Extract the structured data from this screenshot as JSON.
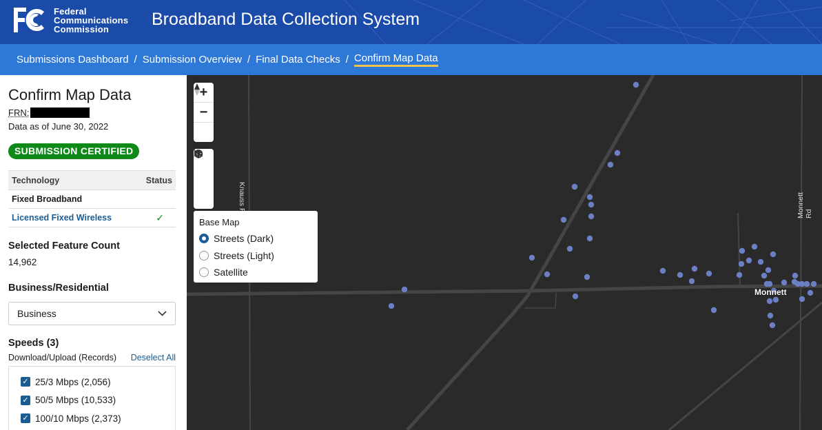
{
  "header": {
    "logo_lines": [
      "Federal",
      "Communications",
      "Commission"
    ],
    "app_title": "Broadband Data Collection System"
  },
  "breadcrumb": {
    "items": [
      "Submissions Dashboard",
      "Submission Overview",
      "Final Data Checks",
      "Confirm Map Data"
    ],
    "separator": "/"
  },
  "sidebar": {
    "title": "Confirm Map Data",
    "frn_label": "FRN:",
    "data_as_of": "Data as of June 30, 2022",
    "status_badge": "SUBMISSION CERTIFIED",
    "tech_table": {
      "headers": [
        "Technology",
        "Status"
      ],
      "rows": [
        {
          "technology": "Fixed Broadband",
          "status": ""
        },
        {
          "technology": "Licensed Fixed Wireless",
          "status": "✓"
        }
      ]
    },
    "feature_count_label": "Selected Feature Count",
    "feature_count_value": "14,962",
    "business_label": "Business/Residential",
    "business_selected": "Business",
    "speeds_label": "Speeds (3)",
    "speeds_sub": "Download/Upload (Records)",
    "deselect_all": "Deselect All",
    "speeds": [
      {
        "label": "25/3 Mbps (2,056)",
        "checked": true
      },
      {
        "label": "50/5 Mbps (10,533)",
        "checked": true
      },
      {
        "label": "100/10 Mbps (2,373)",
        "checked": true
      }
    ]
  },
  "map": {
    "basemap_title": "Base Map",
    "basemap_options": [
      {
        "label": "Streets (Dark)",
        "selected": true
      },
      {
        "label": "Streets (Light)",
        "selected": false
      },
      {
        "label": "Satellite",
        "selected": false
      }
    ],
    "road_labels": [
      "Knauss R",
      "Monnett Rd"
    ],
    "town_label": "Monnett",
    "colors": {
      "background": "#2a2a2a",
      "road": "#444444",
      "point": "#6b7fc4"
    }
  }
}
